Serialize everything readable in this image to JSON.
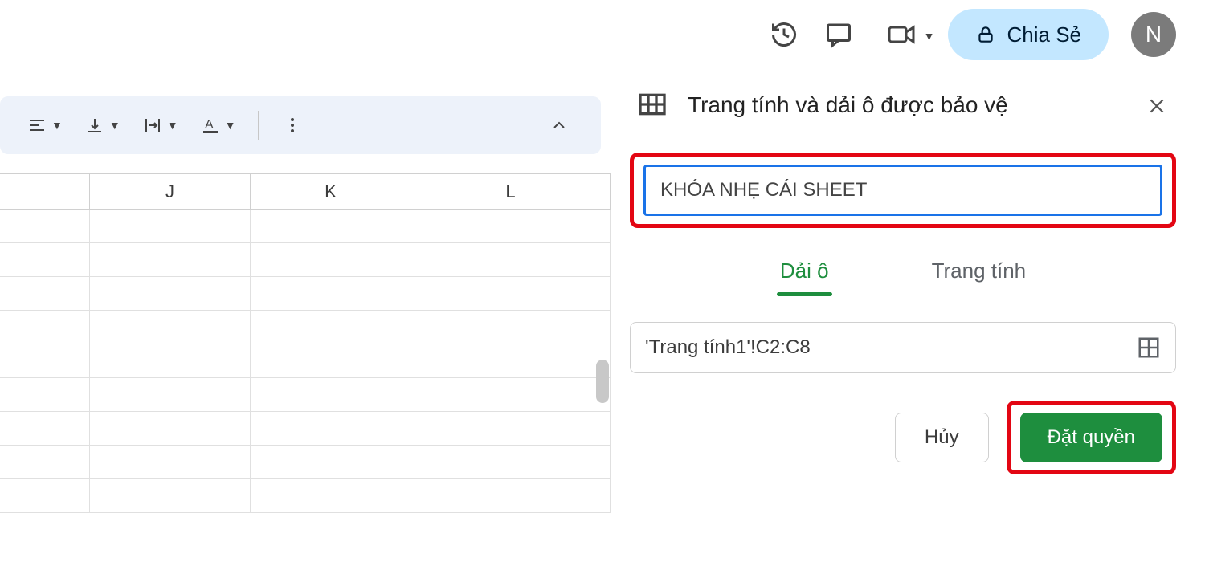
{
  "topbar": {
    "share_label": "Chia Sẻ",
    "avatar_initial": "N"
  },
  "toolbar": {
    "items": [
      "align",
      "valign",
      "wrap",
      "textcolor"
    ]
  },
  "sheet": {
    "columns": [
      "J",
      "K",
      "L"
    ],
    "row_count": 9
  },
  "panel": {
    "title": "Trang tính và dải ô được bảo vệ",
    "description_value": "KHÓA NHẸ CÁI SHEET",
    "tabs": {
      "range": "Dải ô",
      "sheet": "Trang tính",
      "active": "range"
    },
    "range_value": "'Trang tính1'!C2:C8",
    "cancel_label": "Hủy",
    "primary_label": "Đặt quyền"
  }
}
